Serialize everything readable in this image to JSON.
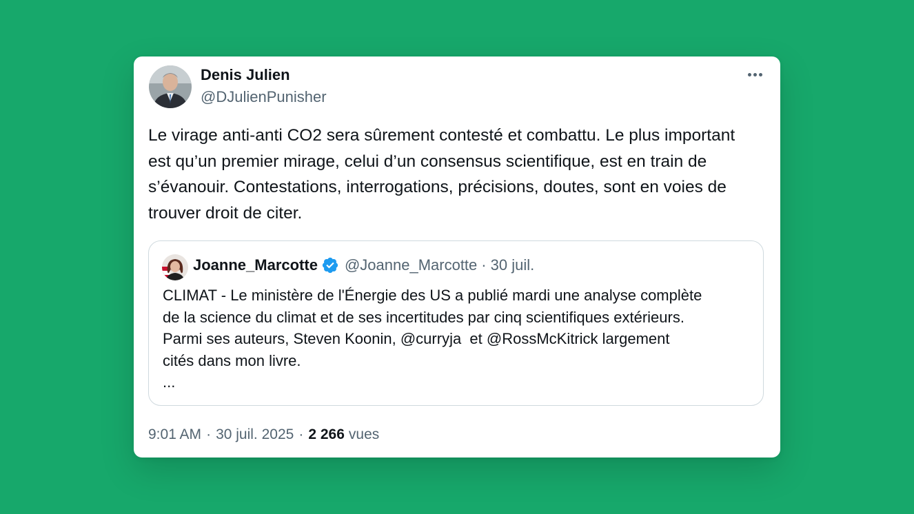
{
  "tweet": {
    "author": {
      "name": "Denis Julien",
      "handle": "@DJulienPunisher"
    },
    "more_icon": "more-horizontal-icon",
    "text": "Le virage anti-anti CO2 sera sûrement contesté et combattu. Le plus important est qu’un premier mirage, celui d’un consensus scientifique, est en train de s’évanouir. Contestations, interrogations, précisions, doutes, sont en voies de trouver droit de citer.",
    "quote": {
      "name": "Joanne_Marcotte",
      "verified_icon": "verified-badge-icon",
      "handle": "@Joanne_Marcotte",
      "separator": "·",
      "date": "30 juil.",
      "lines": [
        "CLIMAT - Le ministère de l'Énergie des US a publié mardi une analyse complète",
        "de la science du climat et de ses incertitudes par cinq scientifiques extérieurs.",
        "Parmi ses auteurs, Steven Koonin, @curryja  et @RossMcKitrick largement",
        "cités dans mon livre.",
        "..."
      ]
    },
    "meta": {
      "time": "9:01 AM",
      "separator": "·",
      "date": "30 juil. 2025",
      "views_count": "2 266",
      "views_label": "vues"
    }
  },
  "colors": {
    "background": "#17a86b",
    "card": "#ffffff",
    "text": "#0f1419",
    "secondary": "#536471",
    "verified": "#1d9bf0",
    "border": "#cfd9de"
  }
}
